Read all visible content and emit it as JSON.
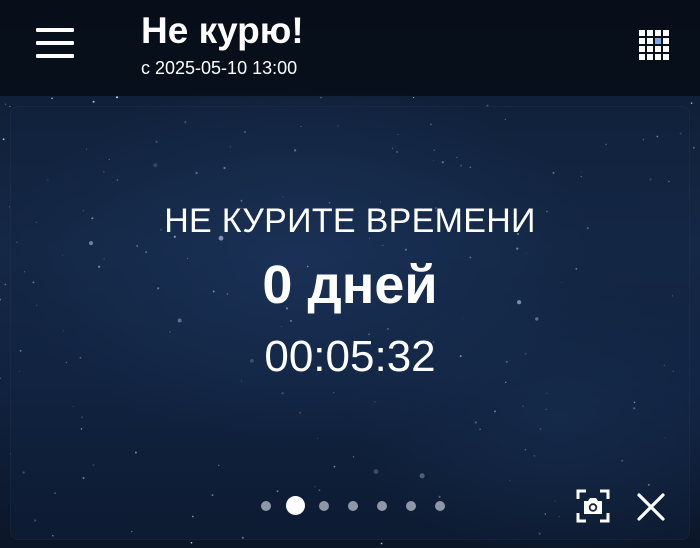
{
  "header": {
    "title": "Не курю!",
    "subtitle": "с 2025-05-10 13:00"
  },
  "icons": {
    "menu": "hamburger-menu-icon",
    "apps": "grid-apps-icon",
    "screenshot": "camera-screenshot-icon",
    "close": "close-icon"
  },
  "counter": {
    "label": "НЕ КУРИТЕ ВРЕМЕНИ",
    "days": "0 дней",
    "time": "00:05:32"
  },
  "pager": {
    "count": 7,
    "active": 1
  },
  "colors": {
    "header_bg": "#060c16",
    "text": "#ffffff",
    "dot_inactive": "#8e97a6",
    "dot_active": "#ffffff",
    "grid_accent": "#7fa6e8"
  }
}
